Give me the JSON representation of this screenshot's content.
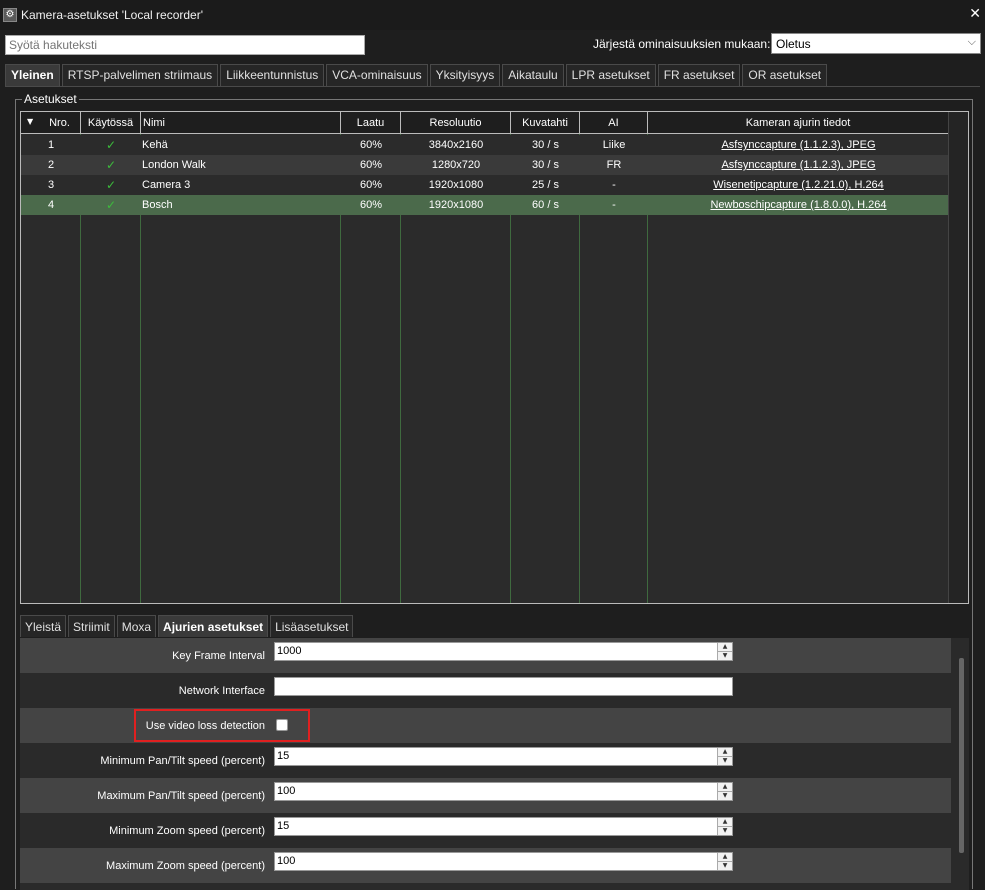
{
  "window": {
    "title": "Kamera-asetukset 'Local recorder'",
    "icon": "settings-gear-icon",
    "close_glyph": "✕"
  },
  "search": {
    "placeholder": "Syötä hakuteksti",
    "value": ""
  },
  "sort": {
    "label": "Järjestä ominaisuuksien mukaan:",
    "selected": "Oletus"
  },
  "tabs": [
    {
      "label": "Yleinen",
      "active": true
    },
    {
      "label": "RTSP-palvelimen striimaus"
    },
    {
      "label": "Liikkeentunnistus"
    },
    {
      "label": "VCA-ominaisuus"
    },
    {
      "label": "Yksityisyys"
    },
    {
      "label": "Aikataulu"
    },
    {
      "label": "LPR asetukset"
    },
    {
      "label": "FR asetukset"
    },
    {
      "label": "OR asetukset"
    }
  ],
  "group": {
    "title": "Asetukset"
  },
  "table": {
    "columns": [
      "Nro.",
      "Käytössä",
      "Nimi",
      "Laatu",
      "Resoluutio",
      "Kuvatahti",
      "AI",
      "Kameran ajurin tiedot"
    ],
    "sort_arrow": "▼",
    "check_glyph": "✓",
    "rows": [
      {
        "nro": "1",
        "enabled": true,
        "name": "Kehä",
        "quality": "60%",
        "resolution": "3840x2160",
        "fps": "30 / s",
        "ai": "Liike",
        "driver": "Asfsynccapture (1.1.2.3), JPEG"
      },
      {
        "nro": "2",
        "enabled": true,
        "name": "London Walk",
        "quality": "60%",
        "resolution": "1280x720",
        "fps": "30 / s",
        "ai": "FR",
        "driver": "Asfsynccapture (1.1.2.3), JPEG"
      },
      {
        "nro": "3",
        "enabled": true,
        "name": "Camera 3",
        "quality": "60%",
        "resolution": "1920x1080",
        "fps": "25 / s",
        "ai": "-",
        "driver": "Wisenetipcapture (1.2.21.0), H.264"
      },
      {
        "nro": "4",
        "enabled": true,
        "name": "Bosch",
        "quality": "60%",
        "resolution": "1920x1080",
        "fps": "60 / s",
        "ai": "-",
        "driver": "Newboschipcapture (1.8.0.0), H.264",
        "selected": true
      }
    ]
  },
  "subtabs": [
    {
      "label": "Yleistä"
    },
    {
      "label": "Striimit"
    },
    {
      "label": "Moxa"
    },
    {
      "label": "Ajurien asetukset",
      "active": true
    },
    {
      "label": "Lisäasetukset"
    }
  ],
  "driver_settings": {
    "key_frame_interval": {
      "label": "Key Frame Interval",
      "value": "1000"
    },
    "network_interface": {
      "label": "Network Interface",
      "value": ""
    },
    "video_loss_detection": {
      "label": "Use video loss detection",
      "checked": false
    },
    "min_pan_tilt": {
      "label": "Minimum Pan/Tilt speed (percent)",
      "value": "15"
    },
    "max_pan_tilt": {
      "label": "Maximum Pan/Tilt speed (percent)",
      "value": "100"
    },
    "min_zoom": {
      "label": "Minimum Zoom speed (percent)",
      "value": "15"
    },
    "max_zoom": {
      "label": "Maximum Zoom speed (percent)",
      "value": "100"
    }
  },
  "colors": {
    "selected_row": "#4b6a4b",
    "check": "#3cbb3c",
    "highlight": "#e02020"
  }
}
